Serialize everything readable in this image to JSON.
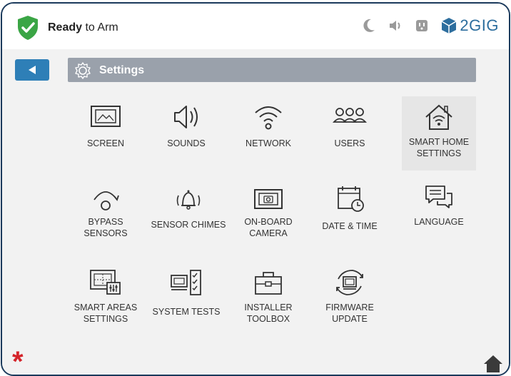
{
  "status": {
    "bold": "Ready",
    "rest": "to Arm",
    "color": "#3aa545"
  },
  "topbar": {
    "icons": [
      "moon-icon",
      "volume-icon",
      "outlet-icon"
    ],
    "brand": "2GIG"
  },
  "nav": {
    "back_label": "Back",
    "title": "Settings"
  },
  "tiles": [
    {
      "key": "screen",
      "label": "SCREEN"
    },
    {
      "key": "sounds",
      "label": "SOUNDS"
    },
    {
      "key": "network",
      "label": "NETWORK"
    },
    {
      "key": "users",
      "label": "USERS"
    },
    {
      "key": "smart-home",
      "label": "SMART HOME\nSETTINGS"
    },
    {
      "key": "bypass",
      "label": "BYPASS\nSENSORS"
    },
    {
      "key": "chimes",
      "label": "SENSOR CHIMES"
    },
    {
      "key": "camera",
      "label": "ON-BOARD\nCAMERA"
    },
    {
      "key": "datetime",
      "label": "DATE & TIME"
    },
    {
      "key": "language",
      "label": "LANGUAGE"
    },
    {
      "key": "smart-areas",
      "label": "SMART AREAS\nSETTINGS"
    },
    {
      "key": "system-tests",
      "label": "SYSTEM TESTS"
    },
    {
      "key": "installer",
      "label": "INSTALLER\nTOOLBOX"
    },
    {
      "key": "firmware",
      "label": "FIRMWARE\nUPDATE"
    }
  ],
  "colors": {
    "accent": "#2e7fb7",
    "alert": "#d4242a",
    "frame": "#1b3a5c"
  }
}
